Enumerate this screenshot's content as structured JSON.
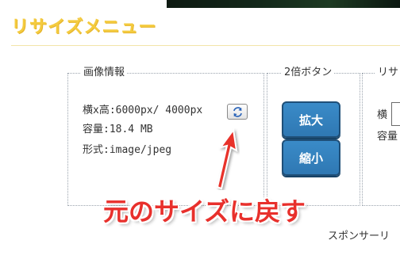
{
  "section": {
    "title": "リサイズメニュー"
  },
  "image_info": {
    "legend": "画像情報",
    "size_line": "横x高:6000px/ 4000px",
    "capacity_line": "容量:18.4 MB",
    "format_line": "形式:image/jpeg",
    "reset_icon": "refresh-icon"
  },
  "double_button": {
    "legend": "2倍ボタン",
    "enlarge_label": "拡大",
    "shrink_label": "縮小"
  },
  "resize": {
    "legend": "リサ",
    "width_label": "横",
    "capacity_label": "容量"
  },
  "annotation": {
    "text": "元のサイズに戻す",
    "color": "#e8302c"
  },
  "footer": {
    "sponsor": "スポンサーリ"
  },
  "colors": {
    "title": "#f4cb3f",
    "button_blue": "#2f78b3",
    "annotation_red": "#e8302c"
  }
}
